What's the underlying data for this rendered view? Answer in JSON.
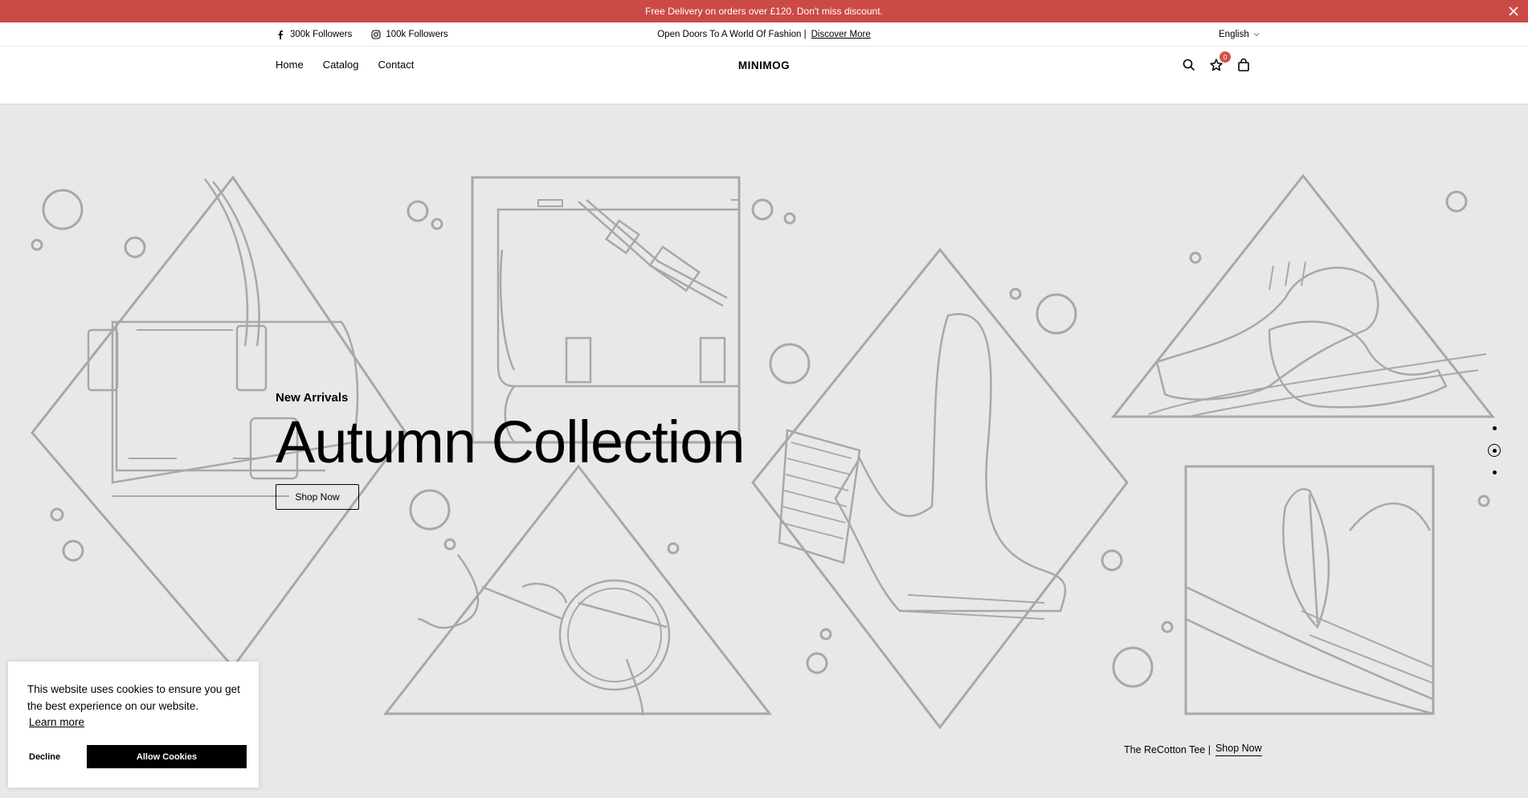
{
  "announcement": {
    "text": "Free Delivery on orders over £120. Don't miss discount."
  },
  "topbar": {
    "facebook": "300k Followers",
    "instagram": "100k Followers",
    "promo_text": "Open Doors To A World Of Fashion |",
    "promo_link": "Discover More",
    "language": "English"
  },
  "header": {
    "nav": [
      "Home",
      "Catalog",
      "Contact"
    ],
    "logo": "MINIMOG",
    "wishlist_count": "0"
  },
  "hero": {
    "subtitle": "New Arrivals",
    "title": "Autumn Collection",
    "button": "Shop Now",
    "bottom_text": "The ReCotton Tee  |",
    "bottom_link": "Shop Now"
  },
  "cookie": {
    "message": "This website uses cookies to ensure you get the best experience on our website.",
    "learn_more": "Learn more",
    "decline": "Decline",
    "allow": "Allow Cookies"
  },
  "colors": {
    "announcement_bg": "#cc4a46",
    "hero_bg": "#e8e8e8",
    "line_art": "#a8a8a8"
  }
}
